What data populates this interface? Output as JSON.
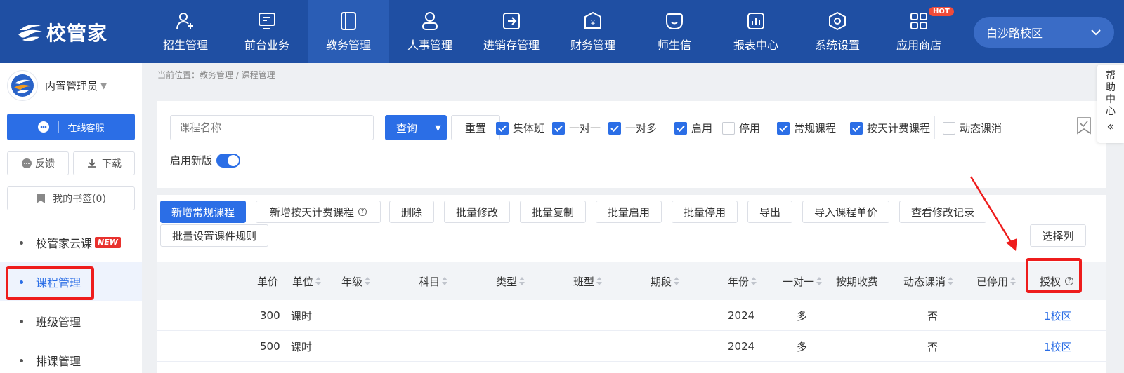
{
  "app": {
    "logo_text": "校管家"
  },
  "nav": [
    {
      "label": "招生管理",
      "icon": "user-plus-icon"
    },
    {
      "label": "前台业务",
      "icon": "monitor-icon"
    },
    {
      "label": "教务管理",
      "icon": "book-icon",
      "active": true
    },
    {
      "label": "人事管理",
      "icon": "person-icon"
    },
    {
      "label": "进销存管理",
      "icon": "export-box-icon"
    },
    {
      "label": "财务管理",
      "icon": "yuan-shield-icon"
    },
    {
      "label": "师生信",
      "icon": "chat-bubble-icon"
    },
    {
      "label": "报表中心",
      "icon": "bar-chart-icon"
    },
    {
      "label": "系统设置",
      "icon": "hexagon-gear-icon"
    },
    {
      "label": "应用商店",
      "icon": "app-grid-icon",
      "badge": "HOT"
    }
  ],
  "campus": {
    "selected": "白沙路校区"
  },
  "sidebar": {
    "user_name": "内置管理员",
    "cs_label": "在线客服",
    "feedback_label": "反馈",
    "download_label": "下载",
    "bookmarks_label": "我的书签(0)",
    "menu": [
      {
        "label": "校管家云课",
        "badge": "NEW"
      },
      {
        "label": "课程管理",
        "active": true
      },
      {
        "label": "班级管理"
      },
      {
        "label": "排课管理"
      }
    ]
  },
  "breadcrumb": "当前位置：教务管理 / 课程管理",
  "filters": {
    "search_placeholder": "课程名称",
    "query_label": "查询",
    "reset_label": "重置",
    "checkboxes": [
      {
        "label": "集体班",
        "checked": true
      },
      {
        "label": "一对一",
        "checked": true
      },
      {
        "label": "一对多",
        "checked": true
      },
      {
        "label": "启用",
        "checked": true
      },
      {
        "label": "停用",
        "checked": false
      },
      {
        "label": "常规课程",
        "checked": true
      },
      {
        "label": "按天计费课程",
        "checked": true
      },
      {
        "label": "动态课消",
        "checked": false
      }
    ],
    "new_version_label": "启用新版",
    "new_version_on": true
  },
  "help": {
    "chars": [
      "帮",
      "助",
      "中",
      "心"
    ],
    "collapse_glyph": "«"
  },
  "actions": {
    "add_regular": "新增常规课程",
    "add_daily": "新增按天计费课程",
    "delete": "删除",
    "batch_edit": "批量修改",
    "batch_copy": "批量复制",
    "batch_enable": "批量启用",
    "batch_disable": "批量停用",
    "export": "导出",
    "import_price": "导入课程单价",
    "view_log": "查看修改记录",
    "batch_courseware": "批量设置课件规则",
    "select_columns": "选择列"
  },
  "table": {
    "headers": {
      "price": "单价",
      "unit": "单位",
      "grade": "年级",
      "subject": "科目",
      "type": "类型",
      "class_type": "班型",
      "period": "期段",
      "year": "年份",
      "one_to_one": "一对一",
      "term_fee": "按期收费",
      "dynamic": "动态课消",
      "disabled": "已停用",
      "auth": "授权"
    },
    "rows": [
      {
        "price": "300",
        "unit": "课时",
        "year": "2024",
        "one_to_one": "多",
        "dynamic": "否",
        "auth": "1校区"
      },
      {
        "price": "500",
        "unit": "课时",
        "year": "2024",
        "one_to_one": "多",
        "dynamic": "否",
        "auth": "1校区"
      }
    ]
  },
  "colors": {
    "nav_bg": "#1f4fa3",
    "primary": "#2b6ee6",
    "highlight": "#ee1c1c"
  }
}
